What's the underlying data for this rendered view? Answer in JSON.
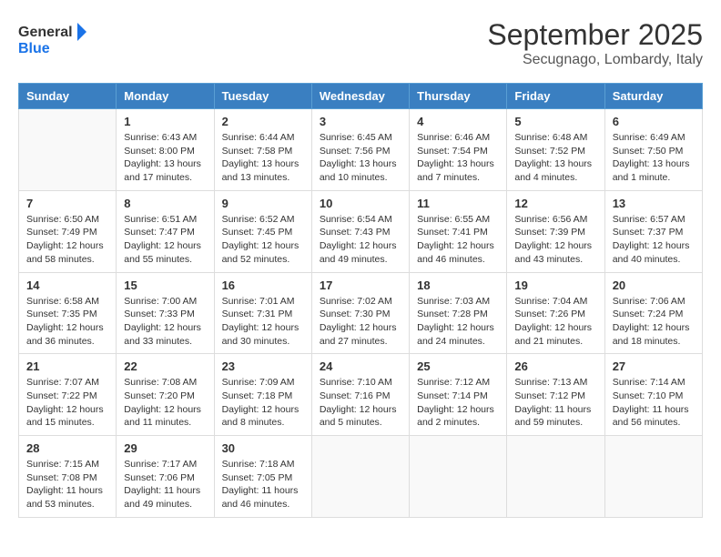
{
  "logo": {
    "text_general": "General",
    "text_blue": "Blue"
  },
  "title": "September 2025",
  "subtitle": "Secugnago, Lombardy, Italy",
  "days_of_week": [
    "Sunday",
    "Monday",
    "Tuesday",
    "Wednesday",
    "Thursday",
    "Friday",
    "Saturday"
  ],
  "weeks": [
    [
      {
        "day": "",
        "info": ""
      },
      {
        "day": "1",
        "info": "Sunrise: 6:43 AM\nSunset: 8:00 PM\nDaylight: 13 hours\nand 17 minutes."
      },
      {
        "day": "2",
        "info": "Sunrise: 6:44 AM\nSunset: 7:58 PM\nDaylight: 13 hours\nand 13 minutes."
      },
      {
        "day": "3",
        "info": "Sunrise: 6:45 AM\nSunset: 7:56 PM\nDaylight: 13 hours\nand 10 minutes."
      },
      {
        "day": "4",
        "info": "Sunrise: 6:46 AM\nSunset: 7:54 PM\nDaylight: 13 hours\nand 7 minutes."
      },
      {
        "day": "5",
        "info": "Sunrise: 6:48 AM\nSunset: 7:52 PM\nDaylight: 13 hours\nand 4 minutes."
      },
      {
        "day": "6",
        "info": "Sunrise: 6:49 AM\nSunset: 7:50 PM\nDaylight: 13 hours\nand 1 minute."
      }
    ],
    [
      {
        "day": "7",
        "info": "Sunrise: 6:50 AM\nSunset: 7:49 PM\nDaylight: 12 hours\nand 58 minutes."
      },
      {
        "day": "8",
        "info": "Sunrise: 6:51 AM\nSunset: 7:47 PM\nDaylight: 12 hours\nand 55 minutes."
      },
      {
        "day": "9",
        "info": "Sunrise: 6:52 AM\nSunset: 7:45 PM\nDaylight: 12 hours\nand 52 minutes."
      },
      {
        "day": "10",
        "info": "Sunrise: 6:54 AM\nSunset: 7:43 PM\nDaylight: 12 hours\nand 49 minutes."
      },
      {
        "day": "11",
        "info": "Sunrise: 6:55 AM\nSunset: 7:41 PM\nDaylight: 12 hours\nand 46 minutes."
      },
      {
        "day": "12",
        "info": "Sunrise: 6:56 AM\nSunset: 7:39 PM\nDaylight: 12 hours\nand 43 minutes."
      },
      {
        "day": "13",
        "info": "Sunrise: 6:57 AM\nSunset: 7:37 PM\nDaylight: 12 hours\nand 40 minutes."
      }
    ],
    [
      {
        "day": "14",
        "info": "Sunrise: 6:58 AM\nSunset: 7:35 PM\nDaylight: 12 hours\nand 36 minutes."
      },
      {
        "day": "15",
        "info": "Sunrise: 7:00 AM\nSunset: 7:33 PM\nDaylight: 12 hours\nand 33 minutes."
      },
      {
        "day": "16",
        "info": "Sunrise: 7:01 AM\nSunset: 7:31 PM\nDaylight: 12 hours\nand 30 minutes."
      },
      {
        "day": "17",
        "info": "Sunrise: 7:02 AM\nSunset: 7:30 PM\nDaylight: 12 hours\nand 27 minutes."
      },
      {
        "day": "18",
        "info": "Sunrise: 7:03 AM\nSunset: 7:28 PM\nDaylight: 12 hours\nand 24 minutes."
      },
      {
        "day": "19",
        "info": "Sunrise: 7:04 AM\nSunset: 7:26 PM\nDaylight: 12 hours\nand 21 minutes."
      },
      {
        "day": "20",
        "info": "Sunrise: 7:06 AM\nSunset: 7:24 PM\nDaylight: 12 hours\nand 18 minutes."
      }
    ],
    [
      {
        "day": "21",
        "info": "Sunrise: 7:07 AM\nSunset: 7:22 PM\nDaylight: 12 hours\nand 15 minutes."
      },
      {
        "day": "22",
        "info": "Sunrise: 7:08 AM\nSunset: 7:20 PM\nDaylight: 12 hours\nand 11 minutes."
      },
      {
        "day": "23",
        "info": "Sunrise: 7:09 AM\nSunset: 7:18 PM\nDaylight: 12 hours\nand 8 minutes."
      },
      {
        "day": "24",
        "info": "Sunrise: 7:10 AM\nSunset: 7:16 PM\nDaylight: 12 hours\nand 5 minutes."
      },
      {
        "day": "25",
        "info": "Sunrise: 7:12 AM\nSunset: 7:14 PM\nDaylight: 12 hours\nand 2 minutes."
      },
      {
        "day": "26",
        "info": "Sunrise: 7:13 AM\nSunset: 7:12 PM\nDaylight: 11 hours\nand 59 minutes."
      },
      {
        "day": "27",
        "info": "Sunrise: 7:14 AM\nSunset: 7:10 PM\nDaylight: 11 hours\nand 56 minutes."
      }
    ],
    [
      {
        "day": "28",
        "info": "Sunrise: 7:15 AM\nSunset: 7:08 PM\nDaylight: 11 hours\nand 53 minutes."
      },
      {
        "day": "29",
        "info": "Sunrise: 7:17 AM\nSunset: 7:06 PM\nDaylight: 11 hours\nand 49 minutes."
      },
      {
        "day": "30",
        "info": "Sunrise: 7:18 AM\nSunset: 7:05 PM\nDaylight: 11 hours\nand 46 minutes."
      },
      {
        "day": "",
        "info": ""
      },
      {
        "day": "",
        "info": ""
      },
      {
        "day": "",
        "info": ""
      },
      {
        "day": "",
        "info": ""
      }
    ]
  ]
}
